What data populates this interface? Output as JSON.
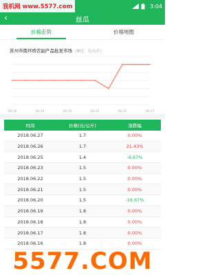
{
  "watermark_top": "我机网 www.5577.com",
  "watermark_bottom": "5577.COM",
  "status": {
    "time": "3:04"
  },
  "header": {
    "back": "‹",
    "title": "丝瓜"
  },
  "tabs": [
    {
      "label": "价格走势",
      "active": true
    },
    {
      "label": "价格地图",
      "active": false
    }
  ],
  "chart": {
    "title": "苏州市南环桥农副产品批发市场",
    "unit": "(单位：元/公斤)"
  },
  "table": {
    "headers": [
      "时间",
      "价格(元/公斤)",
      "涨跌幅"
    ],
    "rows": [
      [
        "2018.06.27",
        "1.7",
        "0.00%"
      ],
      [
        "2018.06.26",
        "1.7",
        "21.43%"
      ],
      [
        "2018.06.25",
        "1.4",
        "-6.67%"
      ],
      [
        "2018.06.23",
        "1.5",
        "0.00%"
      ],
      [
        "2018.06.22",
        "1.5",
        "0.00%"
      ],
      [
        "2018.06.21",
        "1.5",
        "0.00%"
      ],
      [
        "2018.06.20",
        "1.5",
        "-16.67%"
      ],
      [
        "2018.06.19",
        "1.8",
        "0.00%"
      ],
      [
        "2018.06.18",
        "1.8",
        "0.00%"
      ],
      [
        "2018.06.17",
        "1.8",
        "0.00%"
      ],
      [
        "2018.06.16",
        "1.8",
        "0.00%"
      ]
    ]
  },
  "colors": {
    "brand": "#1fb55a",
    "up": "#e24040",
    "down": "#1fb55a",
    "line": "#ff7f66"
  },
  "chart_data": {
    "type": "line",
    "x": [
      "06.16",
      "06.17",
      "06.18",
      "06.19",
      "06.20",
      "06.21",
      "06.22",
      "06.23",
      "06.25",
      "06.26",
      "06.27"
    ],
    "series": [
      {
        "values": [
          1.5,
          1.5,
          1.5,
          1.5,
          1.5,
          1.5,
          1.5,
          1.4,
          1.7,
          1.7,
          1.7
        ]
      }
    ],
    "ylim": [
      1.2,
      1.8
    ],
    "grid": true
  }
}
